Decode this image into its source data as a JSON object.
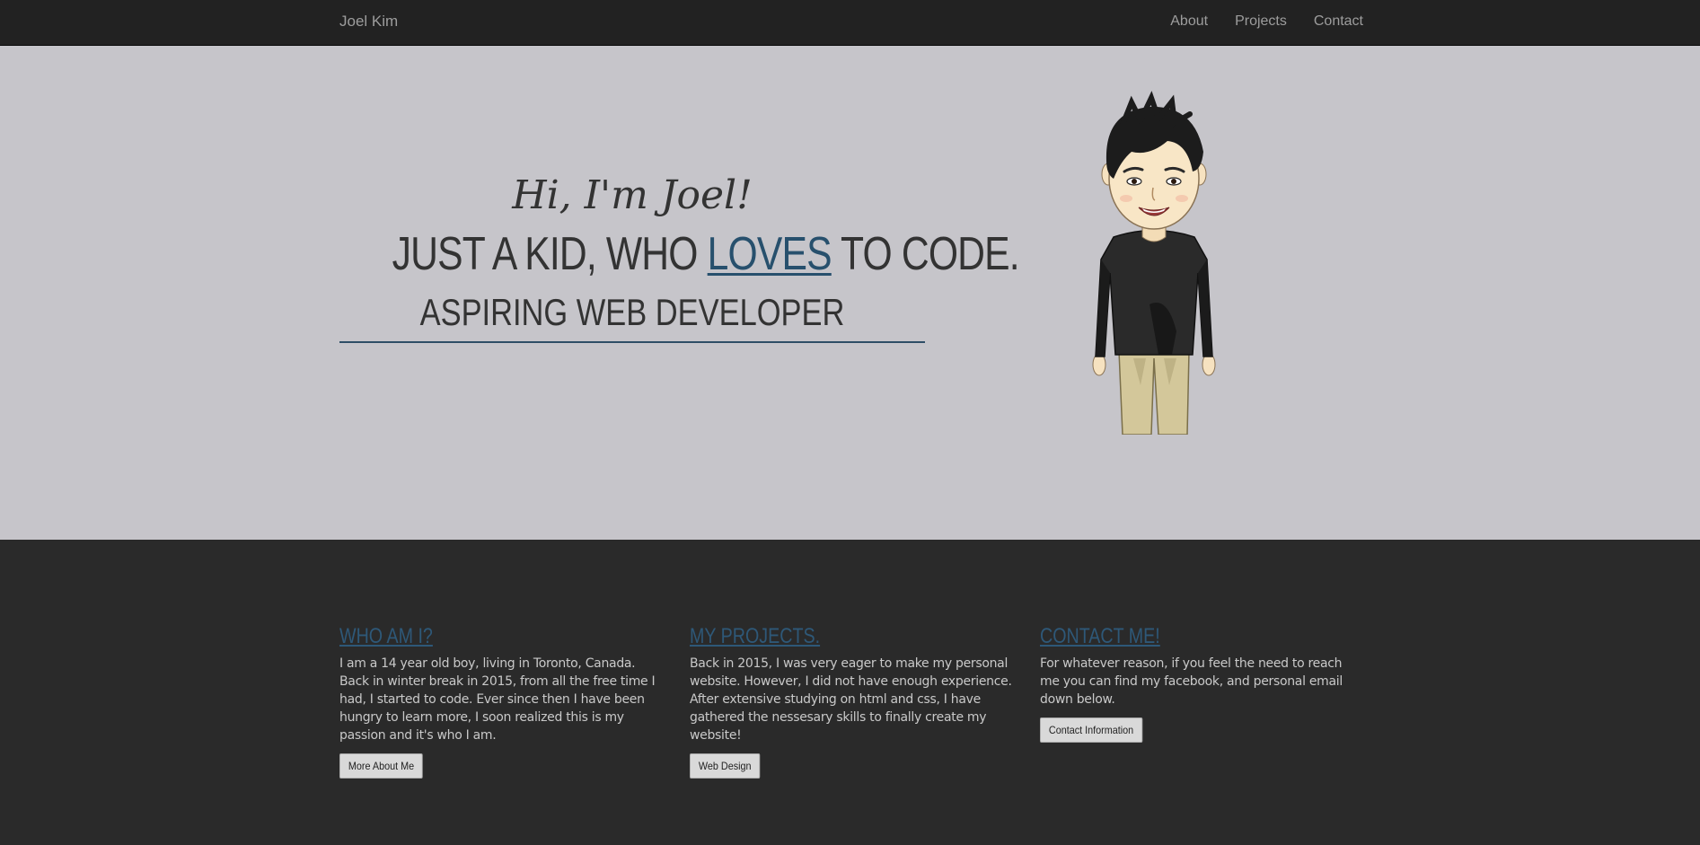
{
  "navbar": {
    "brand": "Joel Kim",
    "links": [
      "About",
      "Projects",
      "Contact"
    ]
  },
  "hero": {
    "greeting": "Hi, I'm Joel!",
    "headline_part1": "JUST A KID, WHO ",
    "headline_highlight": "LOVES",
    "headline_part2": " TO CODE.",
    "subheadline": "ASPIRING WEB DEVELOPER",
    "avatar_icon": "cartoon-boy-avatar"
  },
  "columns": [
    {
      "title": "WHO AM I?",
      "text": "I am a 14 year old boy, living in Toronto, Canada. Back in winter break in 2015, from all the free time I had, I started to code. Ever since then I have been hungry to learn more, I soon realized this is my passion and it's who I am.",
      "button": "More About Me"
    },
    {
      "title": "MY PROJECTS.",
      "text": "Back in 2015, I was very eager to make my personal website. However, I did not have enough experience. After extensive studying on html and css, I have gathered the nessesary skills to finally create my website!",
      "button": "Web Design"
    },
    {
      "title": "CONTACT ME!",
      "text": "For whatever reason, if you feel the need to reach me you can find my facebook, and personal email down below.",
      "button": "Contact Information"
    }
  ],
  "colors": {
    "navbar_bg": "#222222",
    "hero_bg": "#c6c5ca",
    "bottom_bg": "#2a2a2a",
    "accent": "#27506d"
  }
}
